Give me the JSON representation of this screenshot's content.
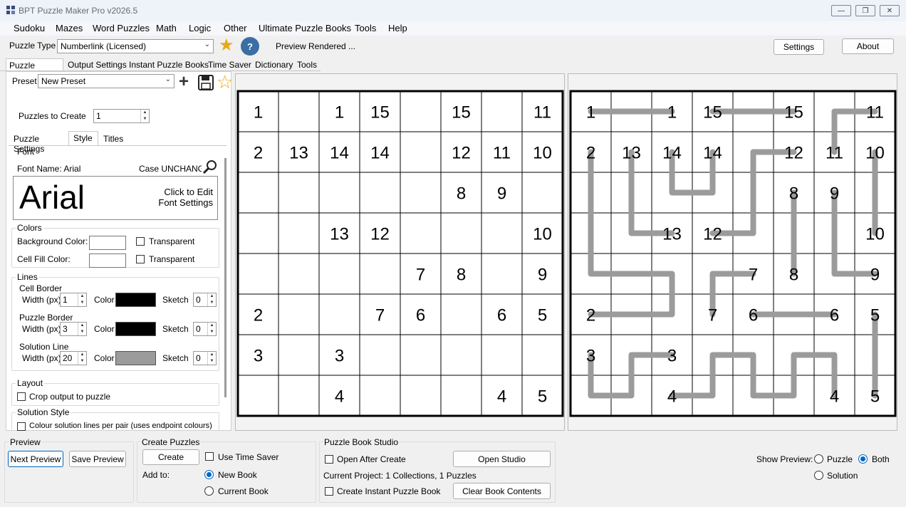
{
  "window": {
    "title": "BPT Puzzle Maker Pro v2026.5"
  },
  "menu": [
    "Sudoku",
    "Mazes",
    "Word Puzzles",
    "Math",
    "Logic",
    "Other",
    "Ultimate Puzzle Books",
    "Tools",
    "Help"
  ],
  "toolbar": {
    "puzzle_type_label": "Puzzle Type",
    "puzzle_type_value": "Numberlink (Licensed)",
    "status": "Preview Rendered ...",
    "settings_label": "Settings",
    "about_label": "About"
  },
  "main_tabs": [
    "Puzzle Settings",
    "Output Settings",
    "Instant Puzzle Books",
    "Time Saver",
    "Dictionary",
    "Tools"
  ],
  "preset": {
    "label": "Preset",
    "value": "New Preset"
  },
  "puzzles_to_create": {
    "label": "Puzzles to Create",
    "value": "1"
  },
  "sub_tabs": [
    "Puzzle Settings",
    "Style",
    "Titles"
  ],
  "font": {
    "group": "Font",
    "name_label": "Font Name: Arial",
    "case_label": "Case UNCHANGE",
    "preview": "Arial",
    "edit_hint_1": "Click to Edit",
    "edit_hint_2": "Font Settings"
  },
  "colors": {
    "group": "Colors",
    "bg_label": "Background Color:",
    "fill_label": "Cell Fill Color:",
    "transparent_label": "Transparent"
  },
  "lines": {
    "group": "Lines",
    "cell_border": {
      "label": "Cell Border",
      "width": "1",
      "color": "#000000",
      "sketch": "0"
    },
    "puzzle_border": {
      "label": "Puzzle Border",
      "width": "3",
      "color": "#000000",
      "sketch": "0"
    },
    "solution_line": {
      "label": "Solution Line",
      "width": "20",
      "color": "#9b9b9b",
      "sketch": "0"
    },
    "width_label": "Width (px)",
    "color_label": "Color",
    "sketch_label": "Sketch"
  },
  "layout": {
    "group": "Layout",
    "crop_label": "Crop output to puzzle"
  },
  "solution_style": {
    "group": "Solution Style",
    "colour_label": "Colour solution lines per pair (uses endpoint colours)"
  },
  "bottom": {
    "preview_group": "Preview",
    "next_preview": "Next Preview",
    "save_preview": "Save Preview",
    "create_group": "Create Puzzles",
    "create": "Create",
    "use_time_saver": "Use Time Saver",
    "add_to": "Add to:",
    "new_book": "New Book",
    "current_book": "Current Book",
    "studio_group": "Puzzle Book Studio",
    "open_after_create": "Open After Create",
    "open_studio": "Open Studio",
    "current_project": "Current Project: 1 Collections, 1 Puzzles",
    "create_instant": "Create Instant Puzzle Book",
    "clear_book": "Clear Book Contents",
    "show_preview": "Show Preview:",
    "opt_puzzle": "Puzzle",
    "opt_both": "Both",
    "opt_solution": "Solution"
  },
  "puzzle_grid": [
    [
      "1",
      "",
      "1",
      "15",
      "",
      "15",
      "",
      "11"
    ],
    [
      "2",
      "13",
      "14",
      "14",
      "",
      "12",
      "11",
      "10"
    ],
    [
      "",
      "",
      "",
      "",
      "",
      "8",
      "9",
      ""
    ],
    [
      "",
      "",
      "13",
      "12",
      "",
      "",
      "",
      "10"
    ],
    [
      "",
      "",
      "",
      "",
      "7",
      "8",
      "",
      "9"
    ],
    [
      "2",
      "",
      "",
      "7",
      "6",
      "",
      "6",
      "5"
    ],
    [
      "3",
      "",
      "3",
      "",
      "",
      "",
      "",
      ""
    ],
    [
      "",
      "",
      "4",
      "",
      "",
      "",
      "4",
      "5"
    ]
  ],
  "solution_paths": [
    [
      [
        0,
        0
      ],
      [
        0,
        1
      ],
      [
        0,
        2
      ]
    ],
    [
      [
        0,
        3
      ],
      [
        0,
        4
      ],
      [
        0,
        5
      ]
    ],
    [
      [
        0,
        7
      ],
      [
        0,
        6
      ],
      [
        1,
        6
      ]
    ],
    [
      [
        1,
        0
      ],
      [
        2,
        0
      ],
      [
        3,
        0
      ],
      [
        4,
        0
      ],
      [
        4,
        1
      ],
      [
        4,
        2
      ],
      [
        5,
        2
      ],
      [
        5,
        1
      ],
      [
        5,
        0
      ]
    ],
    [
      [
        1,
        1
      ],
      [
        2,
        1
      ],
      [
        3,
        1
      ],
      [
        3,
        2
      ]
    ],
    [
      [
        1,
        2
      ],
      [
        2,
        2
      ],
      [
        2,
        3
      ],
      [
        1,
        3
      ]
    ],
    [
      [
        1,
        5
      ],
      [
        1,
        4
      ],
      [
        2,
        4
      ],
      [
        3,
        4
      ],
      [
        3,
        3
      ]
    ],
    [
      [
        2,
        5
      ],
      [
        3,
        5
      ],
      [
        4,
        5
      ]
    ],
    [
      [
        2,
        6
      ],
      [
        3,
        6
      ],
      [
        4,
        6
      ],
      [
        4,
        7
      ]
    ],
    [
      [
        1,
        7
      ],
      [
        2,
        7
      ],
      [
        3,
        7
      ]
    ],
    [
      [
        4,
        4
      ],
      [
        4,
        3
      ],
      [
        5,
        3
      ]
    ],
    [
      [
        5,
        4
      ],
      [
        5,
        5
      ],
      [
        5,
        6
      ]
    ],
    [
      [
        5,
        7
      ],
      [
        6,
        7
      ],
      [
        7,
        7
      ]
    ],
    [
      [
        6,
        0
      ],
      [
        7,
        0
      ],
      [
        7,
        1
      ],
      [
        6,
        1
      ],
      [
        6,
        2
      ]
    ],
    [
      [
        7,
        2
      ],
      [
        7,
        3
      ],
      [
        6,
        3
      ],
      [
        6,
        4
      ],
      [
        7,
        4
      ],
      [
        7,
        5
      ],
      [
        6,
        5
      ],
      [
        6,
        6
      ],
      [
        7,
        6
      ]
    ]
  ]
}
